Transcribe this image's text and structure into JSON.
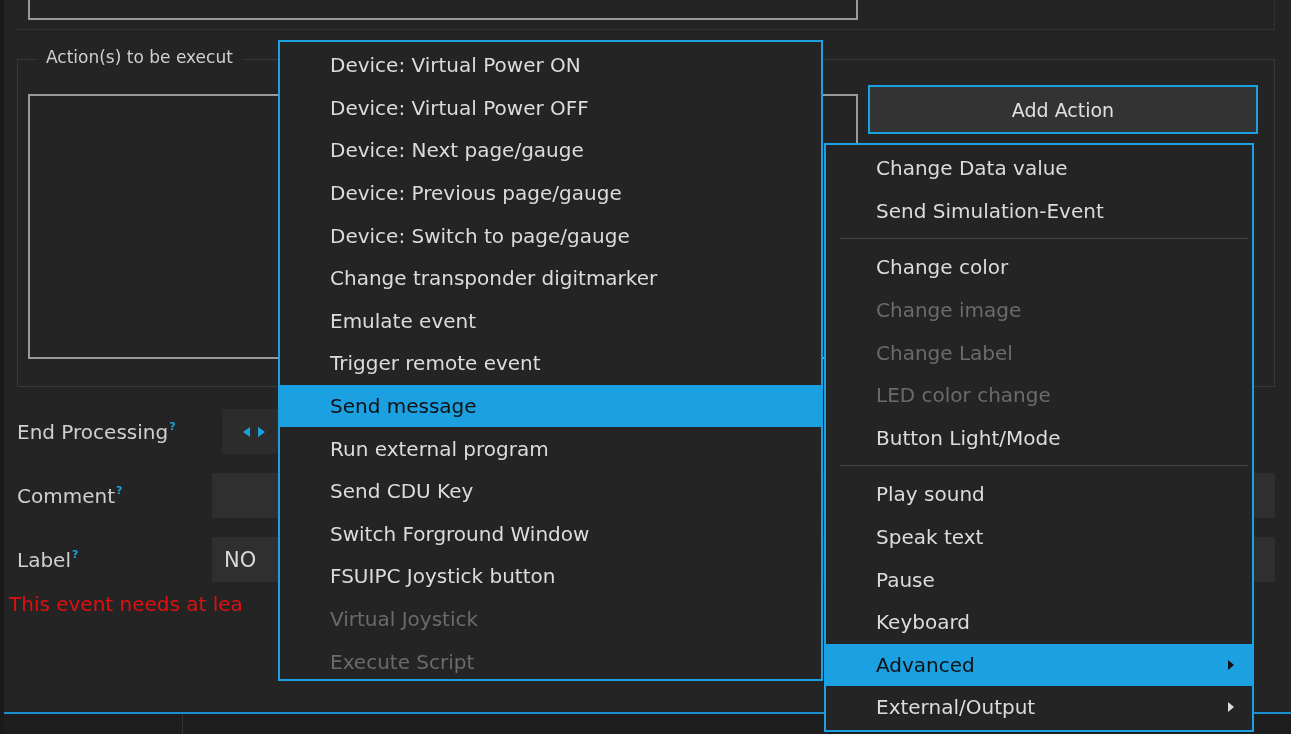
{
  "actions_group": {
    "title": "Action(s) to be execut",
    "add_button": "Add Action"
  },
  "fields": [
    {
      "kind": "spinner",
      "label": "End Processing",
      "help": "?"
    },
    {
      "kind": "text",
      "label": "Comment",
      "help": "?"
    },
    {
      "kind": "text",
      "label": "Label",
      "help": "?",
      "value": "NO"
    }
  ],
  "error": "This event needs at lea",
  "action_menu": {
    "items": [
      {
        "label": "Device: Virtual Power ON",
        "selected": false,
        "disabled": false
      },
      {
        "label": "Device: Virtual Power OFF",
        "selected": false,
        "disabled": false
      },
      {
        "label": "Device: Next page/gauge",
        "selected": false,
        "disabled": false
      },
      {
        "label": "Device: Previous page/gauge",
        "selected": false,
        "disabled": false
      },
      {
        "label": "Device: Switch to page/gauge",
        "selected": false,
        "disabled": false
      },
      {
        "label": "Change transponder digitmarker",
        "selected": false,
        "disabled": false
      },
      {
        "label": "Emulate event",
        "selected": false,
        "disabled": false
      },
      {
        "label": "Trigger remote event",
        "selected": false,
        "disabled": false
      },
      {
        "label": "Send message",
        "selected": true,
        "disabled": false
      },
      {
        "label": "Run external program",
        "selected": false,
        "disabled": false
      },
      {
        "label": "Send CDU Key",
        "selected": false,
        "disabled": false
      },
      {
        "label": "Switch Forground Window",
        "selected": false,
        "disabled": false
      },
      {
        "label": "FSUIPC Joystick button",
        "selected": false,
        "disabled": false
      },
      {
        "label": "Virtual Joystick",
        "selected": false,
        "disabled": true
      },
      {
        "label": "Execute Script",
        "selected": false,
        "disabled": true
      }
    ]
  },
  "add_menu": {
    "items": [
      {
        "kind": "item",
        "label": "Change Data value",
        "selected": false,
        "disabled": false,
        "submenu": false
      },
      {
        "kind": "item",
        "label": "Send Simulation-Event",
        "selected": false,
        "disabled": false,
        "submenu": false
      },
      {
        "kind": "separator"
      },
      {
        "kind": "item",
        "label": "Change color",
        "selected": false,
        "disabled": false,
        "submenu": false
      },
      {
        "kind": "item",
        "label": "Change image",
        "selected": false,
        "disabled": true,
        "submenu": false
      },
      {
        "kind": "item",
        "label": "Change Label",
        "selected": false,
        "disabled": true,
        "submenu": false
      },
      {
        "kind": "item",
        "label": "LED color change",
        "selected": false,
        "disabled": true,
        "submenu": false
      },
      {
        "kind": "item",
        "label": "Button Light/Mode",
        "selected": false,
        "disabled": false,
        "submenu": false
      },
      {
        "kind": "separator"
      },
      {
        "kind": "item",
        "label": "Play sound",
        "selected": false,
        "disabled": false,
        "submenu": false
      },
      {
        "kind": "item",
        "label": "Speak text",
        "selected": false,
        "disabled": false,
        "submenu": false
      },
      {
        "kind": "item",
        "label": "Pause",
        "selected": false,
        "disabled": false,
        "submenu": false
      },
      {
        "kind": "item",
        "label": "Keyboard",
        "selected": false,
        "disabled": false,
        "submenu": false
      },
      {
        "kind": "item",
        "label": "Advanced",
        "selected": true,
        "disabled": false,
        "submenu": true
      },
      {
        "kind": "item",
        "label": "External/Output",
        "selected": false,
        "disabled": false,
        "submenu": true
      }
    ]
  }
}
